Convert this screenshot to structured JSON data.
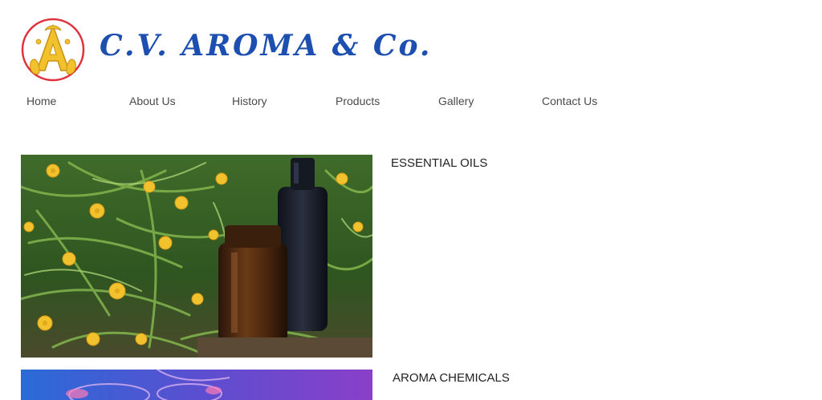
{
  "header": {
    "brand_name": "C.V. AROMA & Co.",
    "logo_letter": "A",
    "brand_color": "#1c4fb0",
    "logo_ring_color": "#e0303a",
    "logo_gold_color": "#f2c12e"
  },
  "nav": {
    "items": [
      {
        "label": "Home"
      },
      {
        "label": "About Us"
      },
      {
        "label": "History"
      },
      {
        "label": "Products"
      },
      {
        "label": "Gallery"
      },
      {
        "label": "Contact Us"
      }
    ],
    "text_color": "#4a4a4a"
  },
  "products": [
    {
      "title": "ESSENTIAL OILS",
      "image": "yellow-flowers-with-amber-bottles-photo"
    },
    {
      "title": "AROMA CHEMICALS",
      "image": "blue-purple-glassware-photo"
    }
  ]
}
